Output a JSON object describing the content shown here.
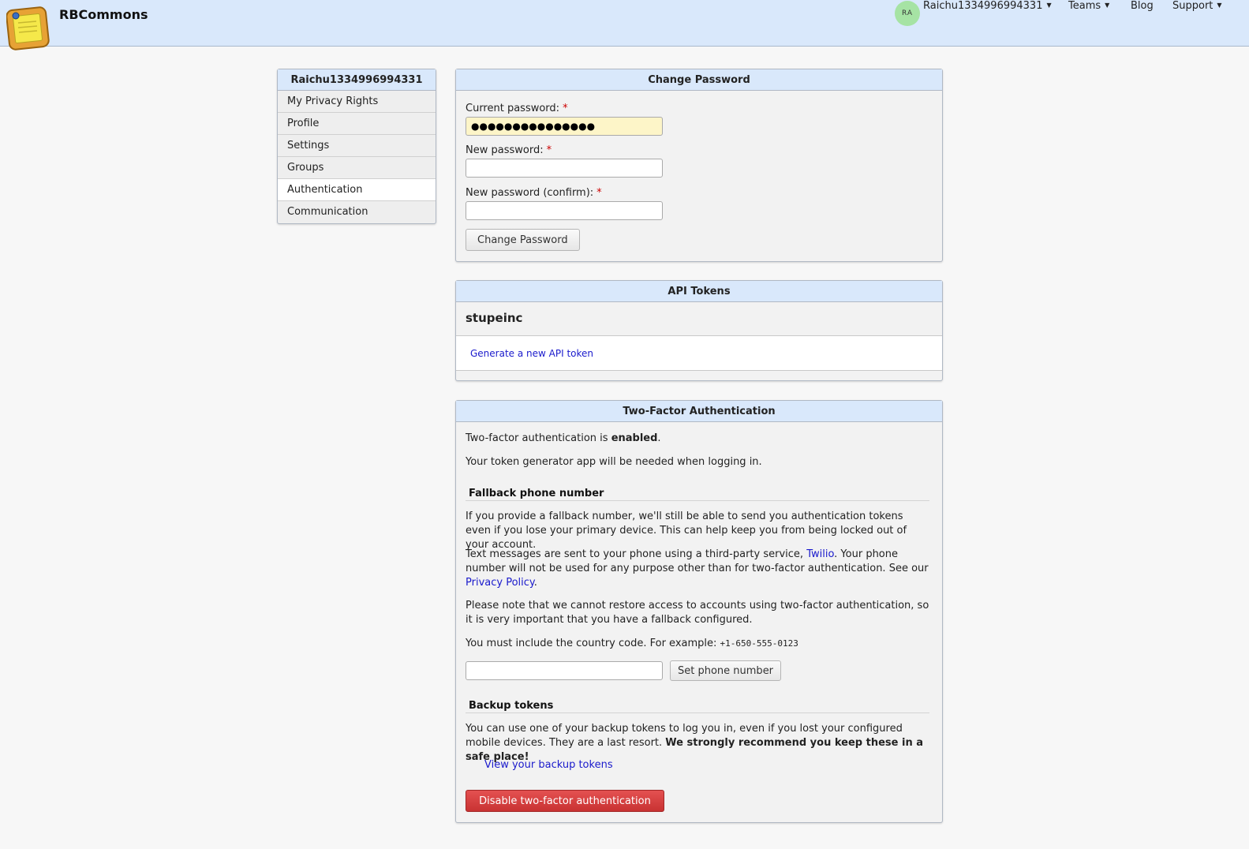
{
  "header": {
    "brand": "RBCommons",
    "user": {
      "initials": "RA",
      "name": "Raichu1334996994331"
    },
    "nav": [
      "Teams",
      "Blog",
      "Support"
    ]
  },
  "sidebar": {
    "title": "Raichu1334996994331",
    "items": [
      {
        "label": "My Privacy Rights"
      },
      {
        "label": "Profile"
      },
      {
        "label": "Settings"
      },
      {
        "label": "Groups"
      },
      {
        "label": "Authentication",
        "active": true
      },
      {
        "label": "Communication"
      }
    ]
  },
  "change_password": {
    "title": "Change Password",
    "current_label": "Current password:",
    "current_value": "●●●●●●●●●●●●●●●",
    "new_label": "New password:",
    "confirm_label": "New password (confirm):",
    "required_mark": "*",
    "submit": "Change Password"
  },
  "api_tokens": {
    "title": "API Tokens",
    "account": "stupeinc",
    "generate_link": "Generate a new API token"
  },
  "two_factor": {
    "title": "Two-Factor Authentication",
    "status_prefix": "Two-factor authentication is ",
    "status_value": "enabled",
    "status_suffix": ".",
    "token_note": "Your token generator app will be needed when logging in.",
    "fallback": {
      "heading": "Fallback phone number",
      "p1": "If you provide a fallback number, we'll still be able to send you authentication tokens even if you lose your primary device. This can help keep you from being locked out of your account.",
      "p2_a": "Text messages are sent to your phone using a third-party service, ",
      "p2_link1": "Twilio",
      "p2_b": ". Your phone number will not be used for any purpose other than for two-factor authentication. See our ",
      "p2_link2": "Privacy Policy",
      "p2_c": ".",
      "p3": "Please note that we cannot restore access to accounts using two-factor authentication, so it is very important that you have a fallback configured.",
      "p4_text": "You must include the country code. For example: ",
      "p4_example": "+1-650-555-0123",
      "phone_value": "",
      "set_button": "Set phone number"
    },
    "backup": {
      "heading": "Backup tokens",
      "p_text": "You can use one of your backup tokens to log you in, even if you lost your configured mobile devices. They are a last resort. ",
      "p_bold": "We strongly recommend you keep these in a safe place!",
      "view_link": "View your backup tokens"
    },
    "disable_button": "Disable two-factor authentication"
  },
  "colors": {
    "header_bg": "#d9e8fb",
    "link": "#1a1acc",
    "danger": "#d23c3c",
    "avatar": "#a6e3a4",
    "autofill": "#fdf5c8"
  }
}
